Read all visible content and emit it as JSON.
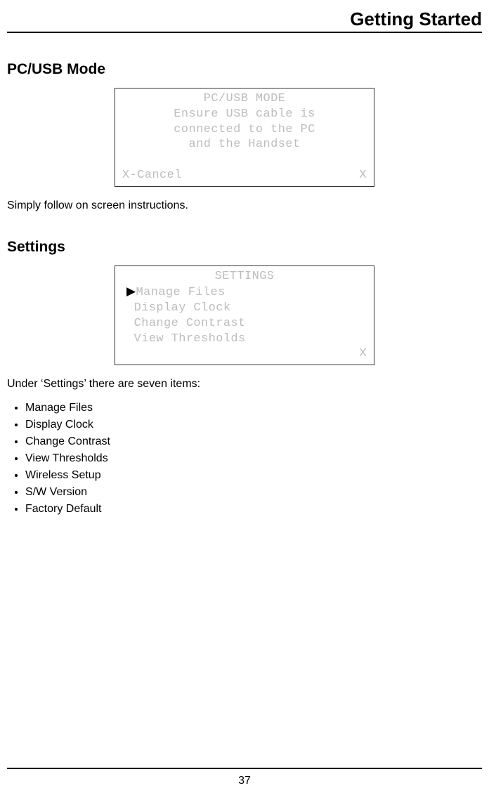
{
  "header": {
    "title": "Getting Started"
  },
  "section1": {
    "heading": "PC/USB Mode",
    "lcd": {
      "title": "PC/USB MODE",
      "line1": "Ensure USB cable is",
      "line2": "connected to the PC",
      "line3": "and the Handset",
      "cancel": "X-Cancel",
      "x": "X"
    },
    "body": "Simply follow on screen instructions."
  },
  "section2": {
    "heading": "Settings",
    "lcd": {
      "title": "SETTINGS",
      "cursor": "▶",
      "items": [
        "Manage Files",
        "Display Clock",
        "Change Contrast",
        "View Thresholds"
      ],
      "x": "X"
    },
    "intro": "Under ‘Settings’ there are seven items:",
    "list": [
      "Manage Files",
      "Display Clock",
      "Change Contrast",
      "View Thresholds",
      "Wireless Setup",
      "S/W Version",
      "Factory Default"
    ]
  },
  "footer": {
    "page": "37"
  }
}
